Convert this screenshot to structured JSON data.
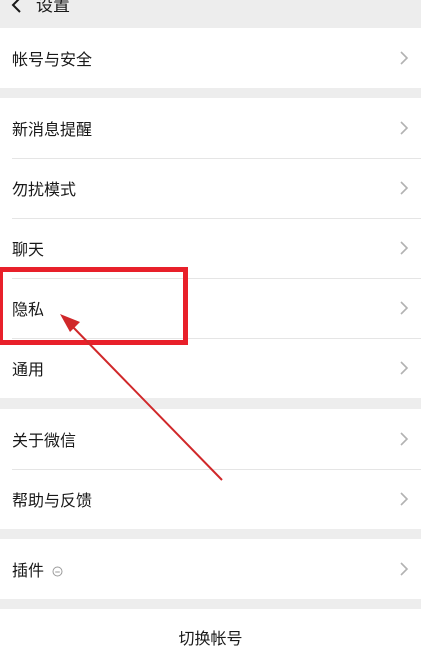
{
  "header": {
    "title": "设置"
  },
  "groups": {
    "account": {
      "items": [
        {
          "label": "帐号与安全"
        }
      ]
    },
    "main": {
      "items": [
        {
          "label": "新消息提醒"
        },
        {
          "label": "勿扰模式"
        },
        {
          "label": "聊天"
        },
        {
          "label": "隐私"
        },
        {
          "label": "通用"
        }
      ]
    },
    "about": {
      "items": [
        {
          "label": "关于微信"
        },
        {
          "label": "帮助与反馈"
        }
      ]
    },
    "plugins": {
      "items": [
        {
          "label": "插件"
        }
      ]
    }
  },
  "footer": {
    "switch_account_label": "切换帐号"
  },
  "annotation": {
    "highlight_color": "#e8202a",
    "arrow_color": "#d0282a"
  },
  "icons": {
    "back": "chevron-left-icon",
    "row_chevron": "chevron-right-icon",
    "plugin_status": "clock-icon"
  }
}
